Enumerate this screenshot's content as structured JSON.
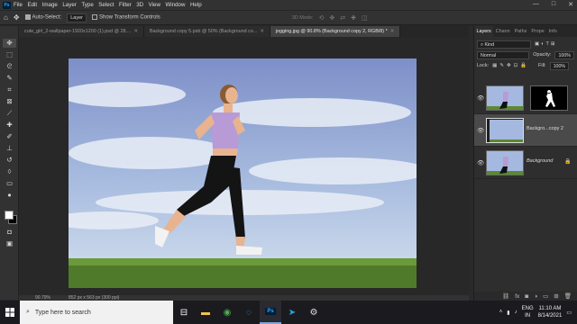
{
  "app": {
    "logo_text": "Ps"
  },
  "menu": [
    "File",
    "Edit",
    "Image",
    "Layer",
    "Type",
    "Select",
    "Filter",
    "3D",
    "View",
    "Window",
    "Help"
  ],
  "window_controls": {
    "minimize": "—",
    "maximize": "□",
    "close": "✕"
  },
  "options_bar": {
    "auto_select_label": "Auto-Select:",
    "auto_select_checked": true,
    "auto_select_target": "Layer",
    "show_transform_label": "Show Transform Controls",
    "show_transform_checked": false,
    "mode_3d_label": "3D Mode:"
  },
  "tabs": [
    {
      "label": "cute_girl_2-wallpaper-1920x1200 (1).psd @ 28....",
      "active": false
    },
    {
      "label": "Background copy 5.psb @ 50% (Background co...",
      "active": false
    },
    {
      "label": "jogging.jpg @ 90.8% (Background copy 2, RGB/8) *",
      "active": true
    }
  ],
  "tools": [
    "move-icon",
    "marquee-icon",
    "lasso-icon",
    "quick-select-icon",
    "crop-icon",
    "frame-icon",
    "eyedropper-icon",
    "healing-icon",
    "brush-icon",
    "stamp-icon",
    "history-brush-icon",
    "eraser-icon",
    "gradient-icon",
    "blur-icon",
    "dodge-icon",
    "pen-icon",
    "type-icon",
    "path-select-icon",
    "shape-icon",
    "hand-icon",
    "zoom-icon",
    "more-tools-icon"
  ],
  "colors": {
    "foreground": "#ffffff",
    "background": "#000000",
    "accent": "#31a8ff"
  },
  "status": {
    "zoom": "90.79%",
    "doc_info": "852 px x 563 px (300 ppi)"
  },
  "panel": {
    "tabs": [
      "Layers",
      "Chann",
      "Paths",
      "Prope",
      "Info"
    ],
    "active_tab": "Layers",
    "filter_label": "Kind",
    "blend_mode": "Normal",
    "opacity_label": "Opacity:",
    "opacity_value": "100%",
    "lock_label": "Lock:",
    "fill_label": "Fill:",
    "fill_value": "100%",
    "layers": [
      {
        "name": "",
        "has_mask": true,
        "selected": false
      },
      {
        "name": "Backgro...copy 2",
        "has_mask": false,
        "selected": true
      },
      {
        "name": "Background",
        "has_mask": false,
        "selected": false,
        "locked": true
      }
    ]
  },
  "taskbar": {
    "search_placeholder": "Type here to search",
    "apps": [
      "task-view-icon",
      "file-explorer-icon",
      "chrome-icon",
      "edge-icon",
      "photoshop-icon",
      "telegram-icon",
      "settings-icon"
    ],
    "language": "ENG",
    "region": "IN",
    "time": "11:10 AM",
    "date": "8/14/2021"
  }
}
